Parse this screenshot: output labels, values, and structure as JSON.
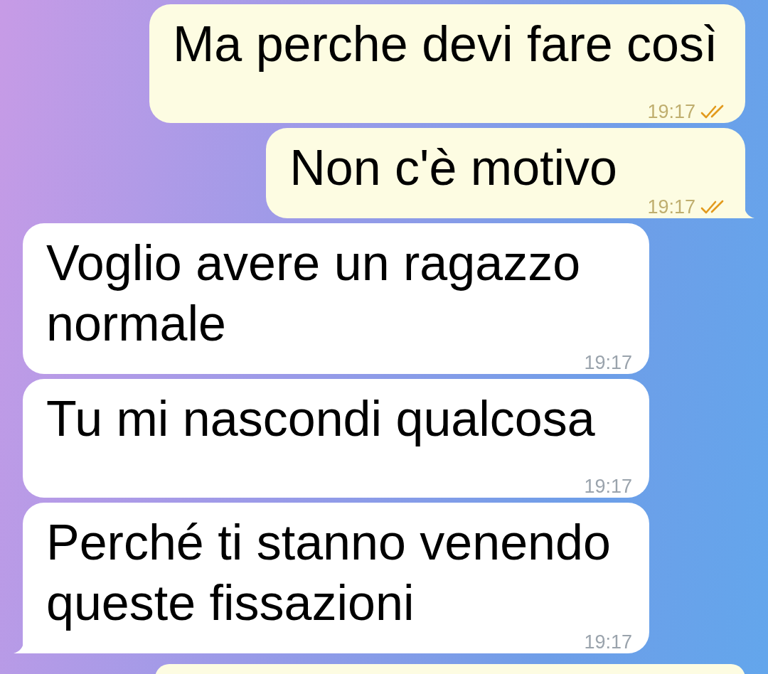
{
  "messages": [
    {
      "kind": "outgoing",
      "text": "Ma perche devi fare così",
      "time": "19:17",
      "read": true,
      "tail": false
    },
    {
      "kind": "outgoing",
      "text": "Non c'è motivo",
      "time": "19:17",
      "read": true,
      "tail": true
    },
    {
      "kind": "incoming",
      "text": "Voglio avere un ragazzo normale",
      "time": "19:17",
      "tail": false
    },
    {
      "kind": "incoming",
      "text": "Tu mi nascondi qualcosa",
      "time": "19:17",
      "tail": false
    },
    {
      "kind": "incoming",
      "text": "Perché ti stanno venendo queste fissazioni",
      "time": "19:17",
      "tail": true
    }
  ]
}
